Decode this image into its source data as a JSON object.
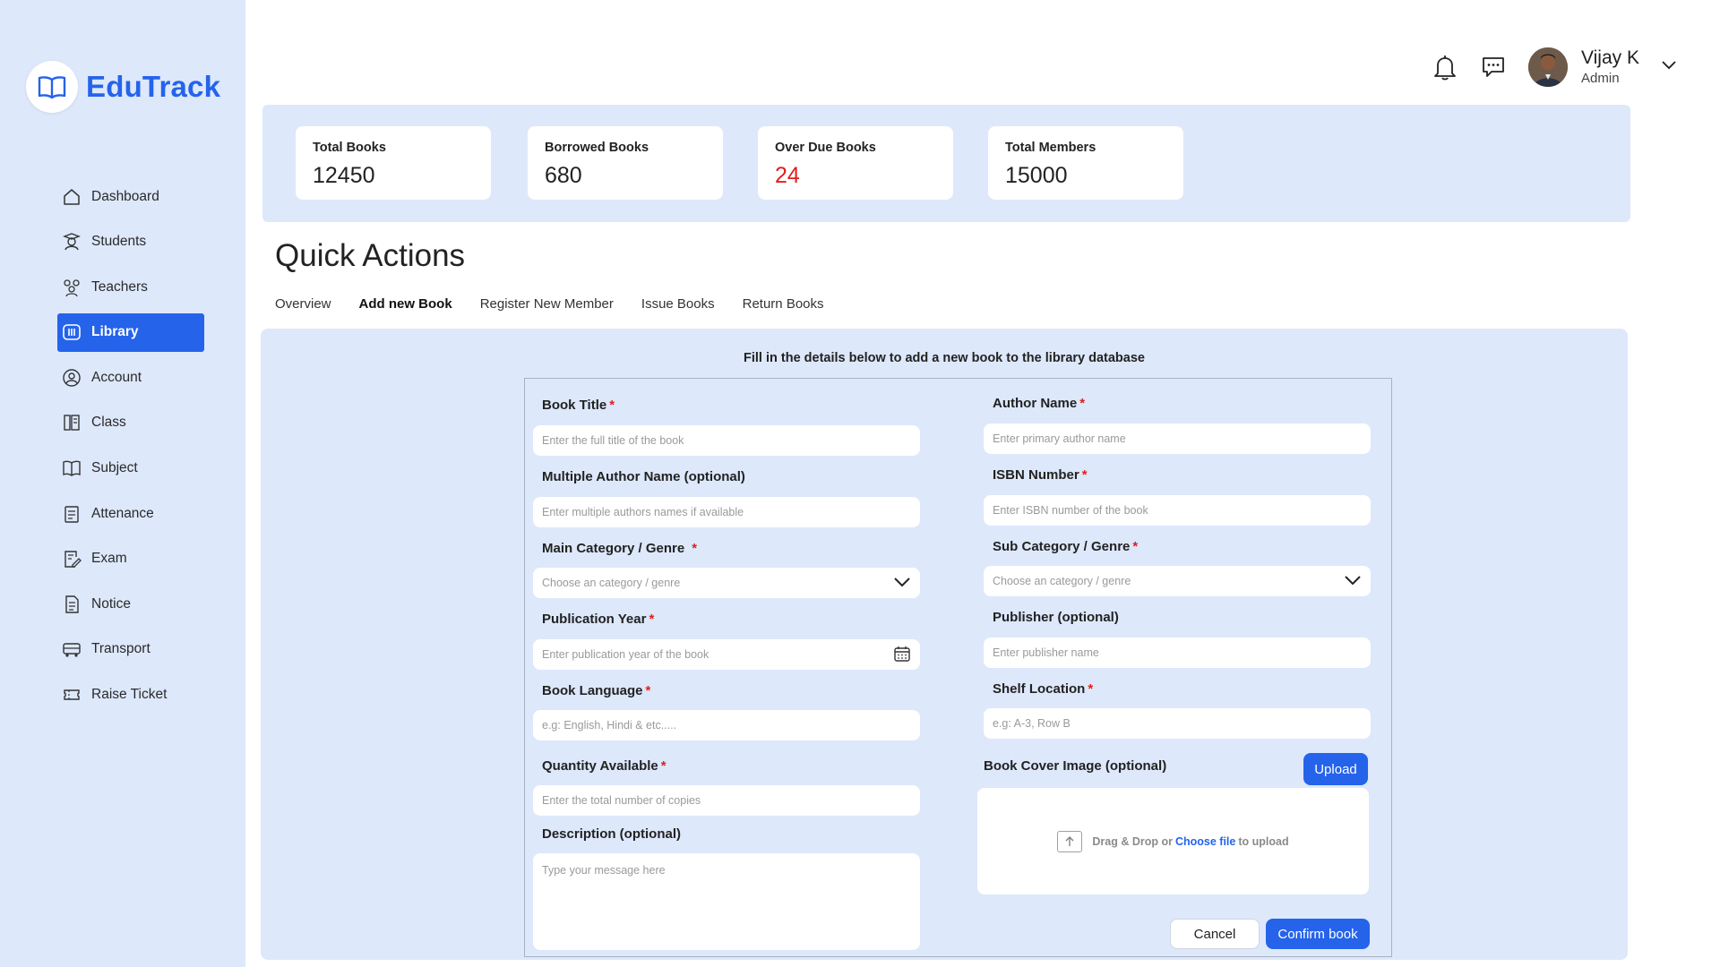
{
  "brand": {
    "name": "EduTrack"
  },
  "sidebar": {
    "items": [
      {
        "label": "Dashboard",
        "icon": "home-icon"
      },
      {
        "label": "Students",
        "icon": "student-icon"
      },
      {
        "label": "Teachers",
        "icon": "teachers-icon"
      },
      {
        "label": "Library",
        "icon": "library-icon",
        "active": true
      },
      {
        "label": "Account",
        "icon": "account-icon"
      },
      {
        "label": "Class",
        "icon": "class-icon"
      },
      {
        "label": "Subject",
        "icon": "book-icon"
      },
      {
        "label": "Attenance",
        "icon": "clipboard-icon"
      },
      {
        "label": "Exam",
        "icon": "exam-icon"
      },
      {
        "label": "Notice",
        "icon": "notice-icon"
      },
      {
        "label": "Transport",
        "icon": "bus-icon"
      },
      {
        "label": "Raise Ticket",
        "icon": "ticket-icon"
      }
    ]
  },
  "header": {
    "user": {
      "name": "Vijay K",
      "role": "Admin"
    }
  },
  "stats": [
    {
      "label": "Total Books",
      "value": "12450"
    },
    {
      "label": "Borrowed Books",
      "value": "680"
    },
    {
      "label": "Over Due Books",
      "value": "24",
      "color": "#e01e1e"
    },
    {
      "label": "Total Members",
      "value": "15000"
    }
  ],
  "quick_actions": {
    "title": "Quick Actions",
    "tabs": [
      {
        "label": "Overview"
      },
      {
        "label": "Add new Book",
        "active": true
      },
      {
        "label": "Register New Member"
      },
      {
        "label": "Issue Books"
      },
      {
        "label": "Return Books"
      }
    ]
  },
  "form": {
    "hint": "Fill in the details below to add a new book to the library database",
    "book_title": {
      "label": "Book Title",
      "placeholder": "Enter the full title of the book"
    },
    "author_name": {
      "label": "Author Name",
      "placeholder": "Enter primary author name"
    },
    "multiple_authors": {
      "label": "Multiple Author Name (optional)",
      "placeholder": "Enter multiple authors names if available"
    },
    "isbn": {
      "label": "ISBN Number",
      "placeholder": "Enter ISBN number of the book"
    },
    "main_category": {
      "label": "Main Category / Genre",
      "placeholder": "Choose an category / genre"
    },
    "sub_category": {
      "label": "Sub Category / Genre",
      "placeholder": "Choose an category / genre"
    },
    "publication_year": {
      "label": "Publication Year",
      "placeholder": "Enter publication year of the book"
    },
    "publisher": {
      "label": "Publisher (optional)",
      "placeholder": "Enter publisher name"
    },
    "book_language": {
      "label": "Book Language",
      "placeholder": "e.g: English,  Hindi & etc....."
    },
    "shelf_location": {
      "label": "Shelf Location",
      "placeholder": "e.g: A-3, Row B"
    },
    "quantity": {
      "label": "Quantity Available",
      "placeholder": "Enter the total number of copies"
    },
    "cover_image": {
      "label": "Book Cover Image (optional)",
      "upload_label": "Upload",
      "drop_text_before": "Drag & Drop or",
      "drop_link": "Choose file",
      "drop_text_after": "to upload"
    },
    "description": {
      "label": "Description (optional)",
      "placeholder": "Type your message here"
    },
    "required_mark": "*",
    "cancel_label": "Cancel",
    "confirm_label": "Confirm book"
  },
  "colors": {
    "accent": "#2563eb",
    "sidebar_bg": "#dde8fb",
    "danger": "#e01e1e"
  }
}
